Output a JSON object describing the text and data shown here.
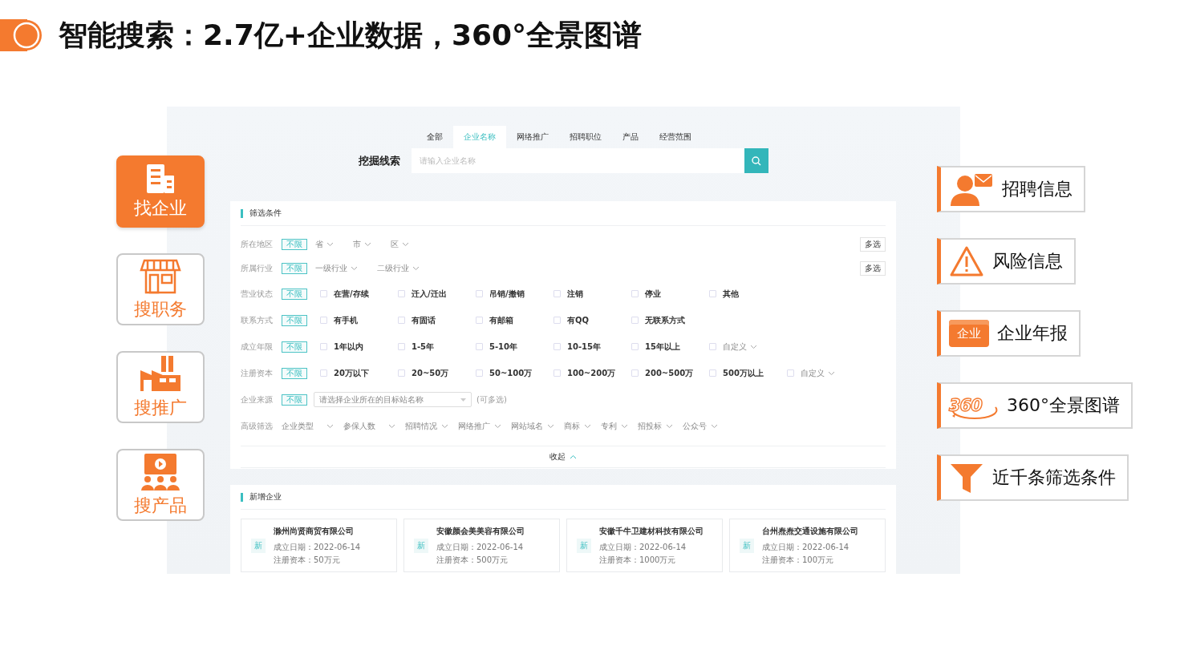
{
  "title": "智能搜索：2.7亿+企业数据，360°全景图谱",
  "left_nav": [
    {
      "label": "找企业",
      "selected": true
    },
    {
      "label": "搜职务",
      "selected": false
    },
    {
      "label": "搜推广",
      "selected": false
    },
    {
      "label": "搜产品",
      "selected": false
    }
  ],
  "app": {
    "tabs": [
      {
        "label": "全部",
        "selected": false
      },
      {
        "label": "企业名称",
        "selected": true
      },
      {
        "label": "网络推广",
        "selected": false
      },
      {
        "label": "招聘职位",
        "selected": false
      },
      {
        "label": "产品",
        "selected": false
      },
      {
        "label": "经营范围",
        "selected": false
      }
    ],
    "search": {
      "label": "挖掘线索",
      "placeholder": "请输入企业名称"
    },
    "filter_panel": {
      "title": "筛选条件",
      "rows": [
        {
          "kind": "dropdowns",
          "label": "所在地区",
          "any": {
            "label": "不限",
            "selected": true
          },
          "dropdowns": [
            "省",
            "市",
            "区"
          ],
          "multi": "多选"
        },
        {
          "kind": "dropdowns",
          "label": "所属行业",
          "any": {
            "label": "不限",
            "selected": true
          },
          "dropdowns": [
            "一级行业",
            "二级行业"
          ],
          "multi": "多选"
        },
        {
          "kind": "checkboxes",
          "label": "营业状态",
          "any": {
            "label": "不限",
            "selected": true
          },
          "options": [
            {
              "kind": "checkbox",
              "label": "在营/存续",
              "checked": false
            },
            {
              "kind": "checkbox",
              "label": "迁入/迁出",
              "checked": false
            },
            {
              "kind": "checkbox",
              "label": "吊销/撤销",
              "checked": false
            },
            {
              "kind": "checkbox",
              "label": "注销",
              "checked": false
            },
            {
              "kind": "checkbox",
              "label": "停业",
              "checked": false
            },
            {
              "kind": "checkbox",
              "label": "其他",
              "checked": false
            }
          ]
        },
        {
          "kind": "checkboxes",
          "label": "联系方式",
          "any": {
            "label": "不限",
            "selected": true
          },
          "options": [
            {
              "kind": "checkbox",
              "label": "有手机",
              "checked": false
            },
            {
              "kind": "checkbox",
              "label": "有固话",
              "checked": false
            },
            {
              "kind": "checkbox",
              "label": "有邮箱",
              "checked": false
            },
            {
              "kind": "checkbox",
              "label": "有QQ",
              "checked": false
            },
            {
              "kind": "checkbox",
              "label": "无联系方式",
              "checked": false
            }
          ]
        },
        {
          "kind": "checkboxes",
          "label": "成立年限",
          "any": {
            "label": "不限",
            "selected": true
          },
          "options": [
            {
              "kind": "checkbox",
              "label": "1年以内",
              "checked": false
            },
            {
              "kind": "checkbox",
              "label": "1-5年",
              "checked": false
            },
            {
              "kind": "checkbox",
              "label": "5-10年",
              "checked": false
            },
            {
              "kind": "checkbox",
              "label": "10-15年",
              "checked": false
            },
            {
              "kind": "checkbox",
              "label": "15年以上",
              "checked": false
            },
            {
              "kind": "custom",
              "label": "自定义",
              "checked": false
            }
          ]
        },
        {
          "kind": "checkboxes",
          "label": "注册资本",
          "any": {
            "label": "不限",
            "selected": true
          },
          "options": [
            {
              "kind": "checkbox",
              "label": "20万以下",
              "checked": false
            },
            {
              "kind": "checkbox",
              "label": "20~50万",
              "checked": false
            },
            {
              "kind": "checkbox",
              "label": "50~100万",
              "checked": false
            },
            {
              "kind": "checkbox",
              "label": "100~200万",
              "checked": false
            },
            {
              "kind": "checkbox",
              "label": "200~500万",
              "checked": false
            },
            {
              "kind": "checkbox",
              "label": "500万以上",
              "checked": false
            },
            {
              "kind": "custom",
              "label": "自定义",
              "checked": false
            }
          ]
        },
        {
          "kind": "select",
          "label": "企业来源",
          "any": {
            "label": "不限",
            "selected": true
          },
          "placeholder": "请选择企业所在的目标站名称",
          "note": "(可多选)"
        },
        {
          "kind": "advanced",
          "label": "高级筛选",
          "dropdowns": [
            "企业类型",
            "参保人数",
            "招聘情况",
            "网络推广",
            "网站域名",
            "商标",
            "专利",
            "招投标",
            "公众号"
          ]
        }
      ],
      "collapse": "收起"
    },
    "new_panel": {
      "title": "新增企业",
      "companies": [
        {
          "badge": "新",
          "name": "滁州尚贤商贸有限公司",
          "date": "成立日期：2022-06-14",
          "capital": "注册资本：50万元"
        },
        {
          "badge": "新",
          "name": "安徽颜会美美容有限公司",
          "date": "成立日期：2022-06-14",
          "capital": "注册资本：500万元"
        },
        {
          "badge": "新",
          "name": "安徽千牛卫建材科技有限公司",
          "date": "成立日期：2022-06-14",
          "capital": "注册资本：1000万元"
        },
        {
          "badge": "新",
          "name": "台州焘焘交通设施有限公司",
          "date": "成立日期：2022-06-14",
          "capital": "注册资本：100万元"
        }
      ]
    }
  },
  "features": [
    {
      "label": "招聘信息"
    },
    {
      "label": "风险信息"
    },
    {
      "label": "企业年报",
      "badge": "企业"
    },
    {
      "label": "360°全景图谱",
      "badge": "360"
    },
    {
      "label": "近千条筛选条件"
    }
  ]
}
